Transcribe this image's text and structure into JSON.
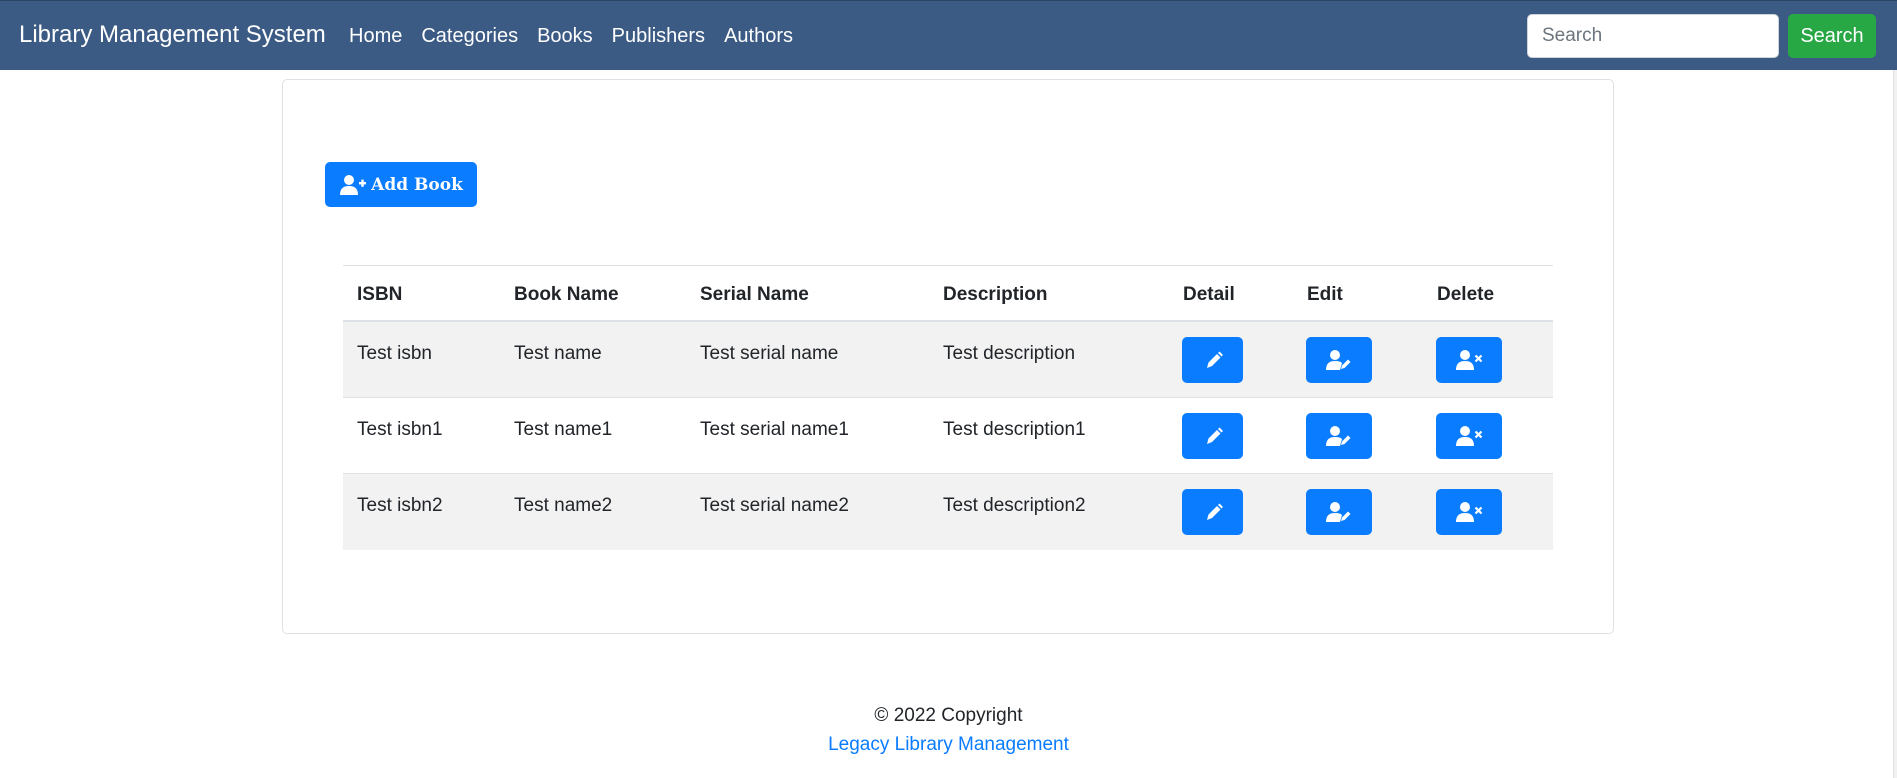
{
  "navbar": {
    "brand": "Library Management System",
    "links": [
      {
        "label": "Home"
      },
      {
        "label": "Categories"
      },
      {
        "label": "Books"
      },
      {
        "label": "Publishers"
      },
      {
        "label": "Authors"
      }
    ],
    "search": {
      "placeholder": "Search",
      "value": "",
      "button_label": "Search"
    }
  },
  "main": {
    "add_button_label": "Add Book",
    "table": {
      "headers": [
        "ISBN",
        "Book Name",
        "Serial Name",
        "Description",
        "Detail",
        "Edit",
        "Delete"
      ],
      "rows": [
        {
          "isbn": "Test isbn",
          "name": "Test name",
          "serial": "Test serial name",
          "description": "Test description"
        },
        {
          "isbn": "Test isbn1",
          "name": "Test name1",
          "serial": "Test serial name1",
          "description": "Test description1"
        },
        {
          "isbn": "Test isbn2",
          "name": "Test name2",
          "serial": "Test serial name2",
          "description": "Test description2"
        }
      ]
    }
  },
  "footer": {
    "copyright": "© 2022 Copyright",
    "link_text": "Legacy Library Management"
  },
  "colors": {
    "navbar_bg": "#3b5b84",
    "primary": "#0a7cff",
    "success": "#28a745",
    "stripe": "#f2f2f2"
  },
  "icons": {
    "add": "user-plus-icon",
    "detail": "pen-icon",
    "edit": "user-edit-icon",
    "delete": "user-times-icon"
  }
}
